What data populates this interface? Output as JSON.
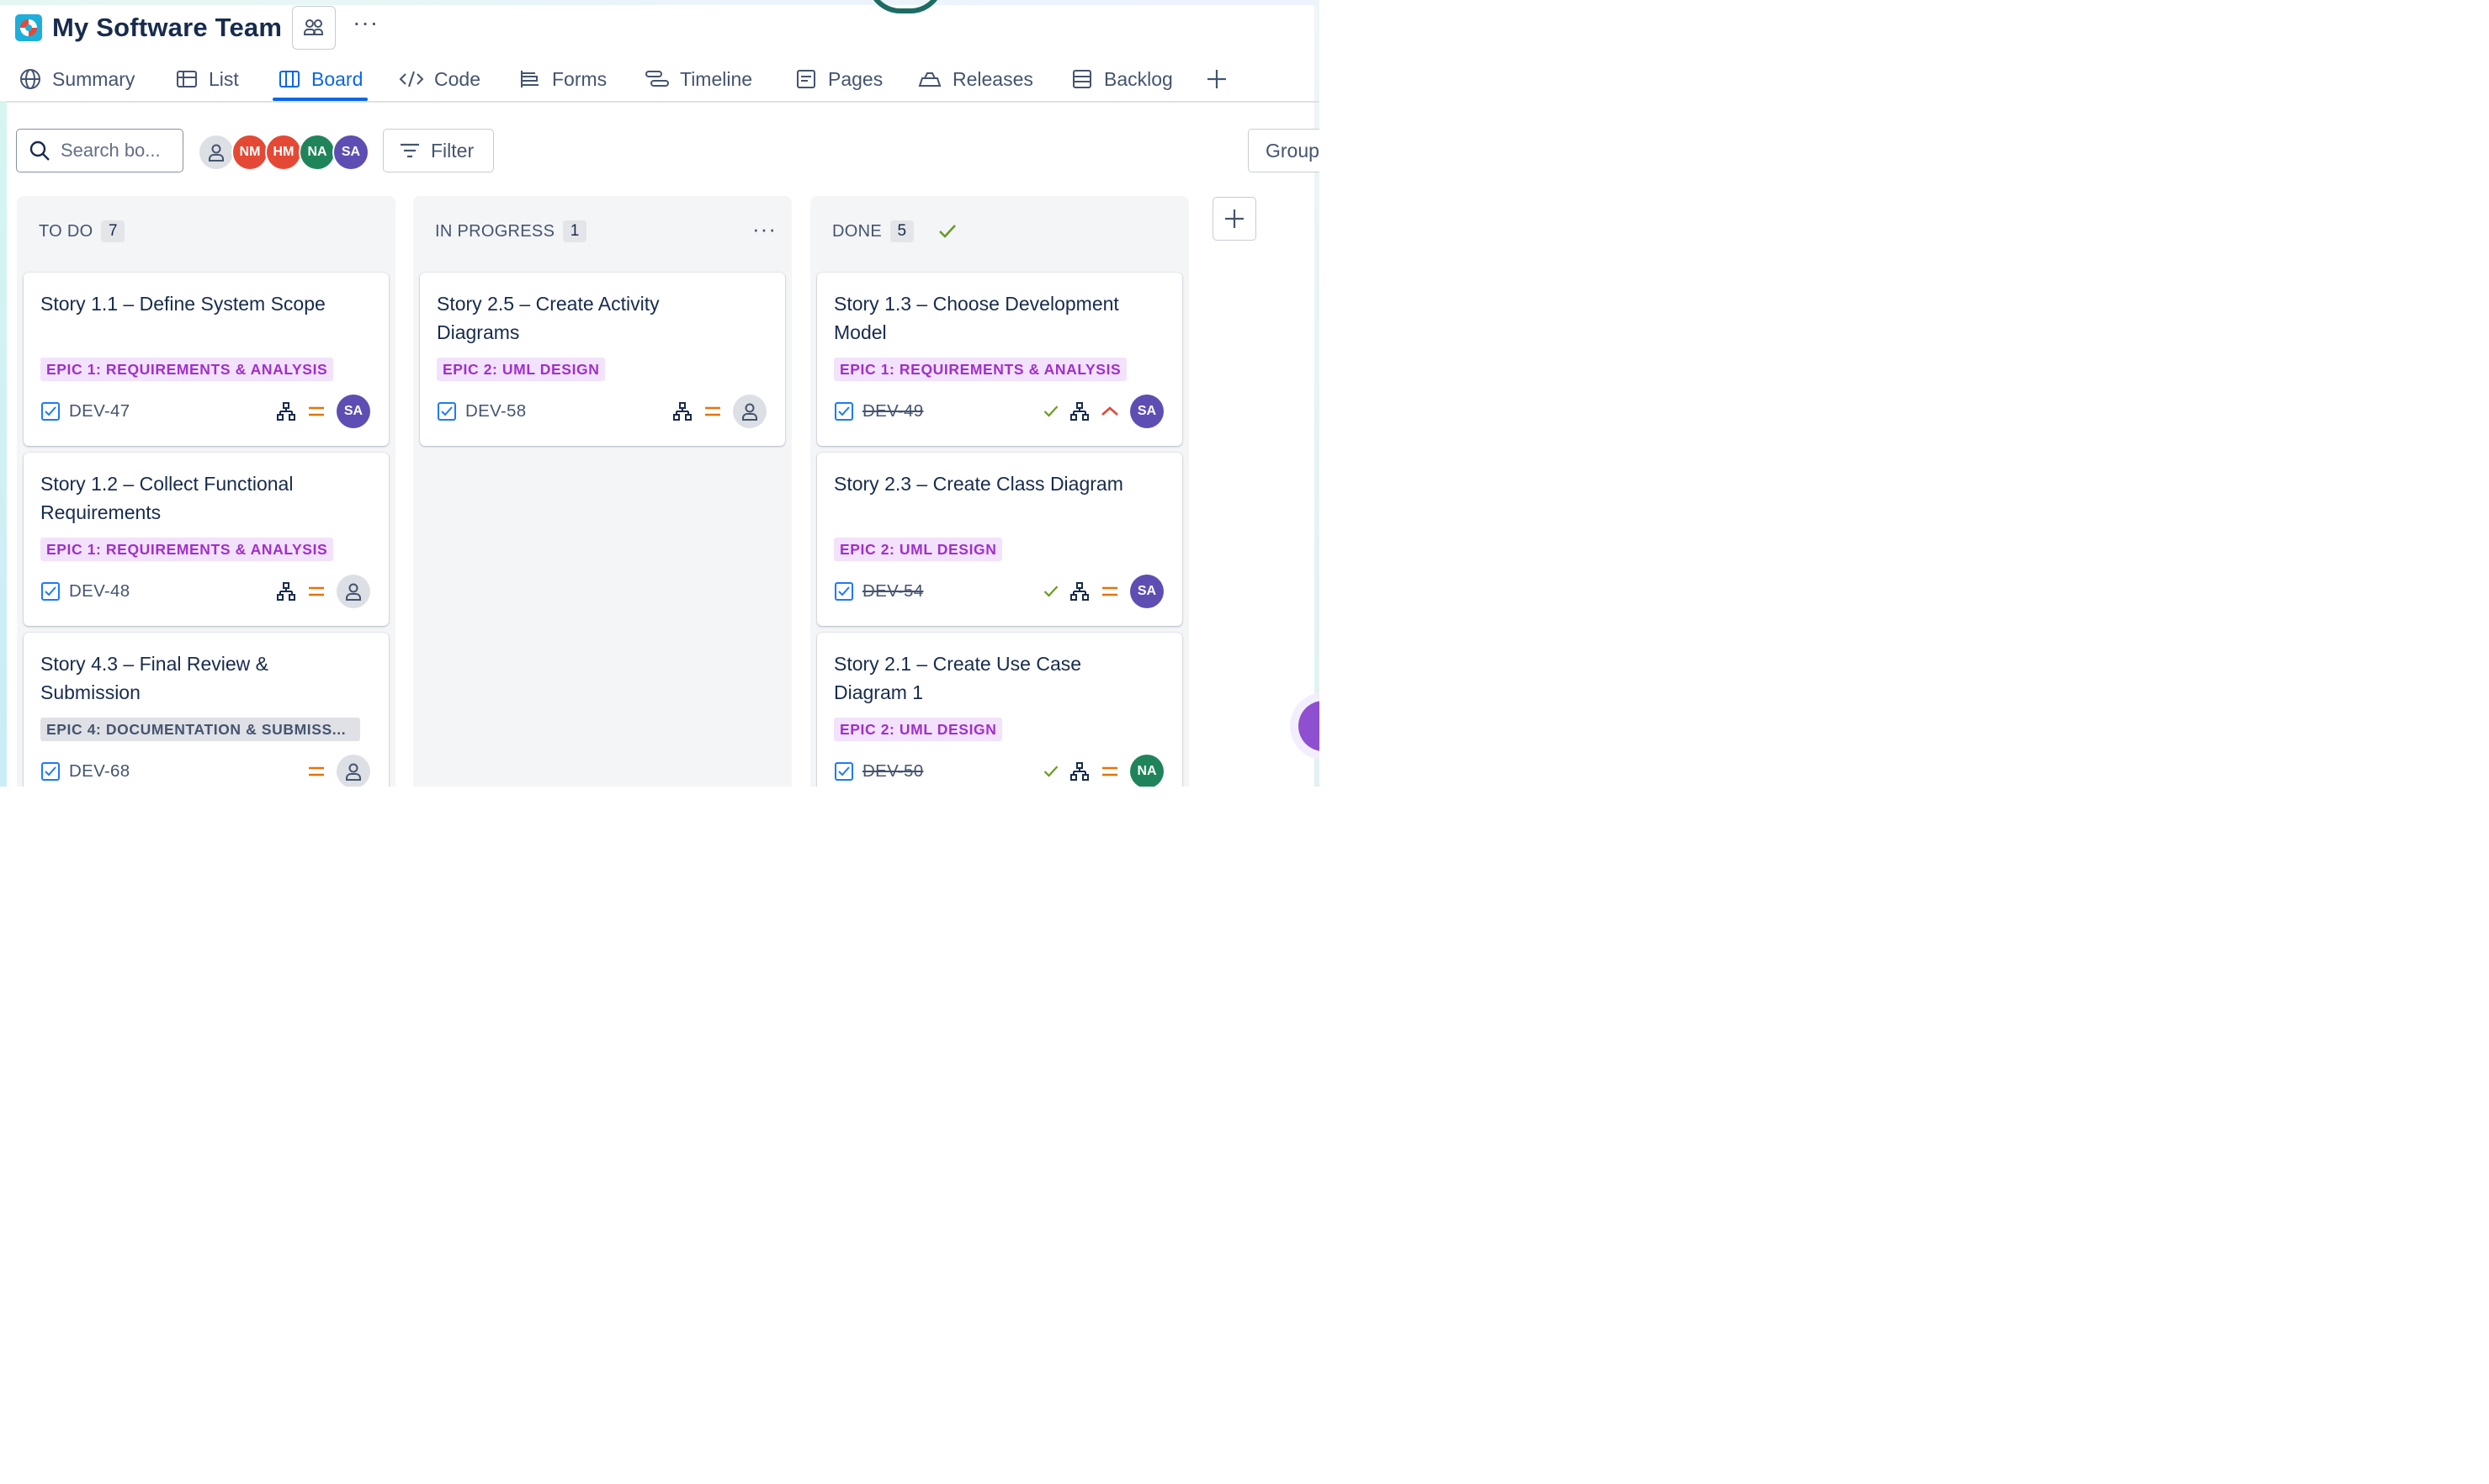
{
  "project": {
    "title": "My Software Team"
  },
  "tabs": [
    {
      "label": "Summary",
      "icon": "globe-icon"
    },
    {
      "label": "List",
      "icon": "list-icon"
    },
    {
      "label": "Board",
      "icon": "board-icon",
      "active": true
    },
    {
      "label": "Code",
      "icon": "code-icon"
    },
    {
      "label": "Forms",
      "icon": "forms-icon"
    },
    {
      "label": "Timeline",
      "icon": "timeline-icon"
    },
    {
      "label": "Pages",
      "icon": "pages-icon"
    },
    {
      "label": "Releases",
      "icon": "releases-icon"
    },
    {
      "label": "Backlog",
      "icon": "backlog-icon"
    }
  ],
  "toolbar": {
    "search_placeholder": "Search bo...",
    "avatars": [
      {
        "initials": "",
        "color": "#dcdfe4"
      },
      {
        "initials": "NM",
        "color": "#e34935"
      },
      {
        "initials": "HM",
        "color": "#e34935"
      },
      {
        "initials": "NA",
        "color": "#1f845a"
      },
      {
        "initials": "SA",
        "color": "#5e4db2"
      }
    ],
    "filter_label": "Filter",
    "group_label": "Group"
  },
  "columns": [
    {
      "name": "TO DO",
      "count": "7",
      "cards": [
        {
          "title": "Story 1.1 – Define System Scope",
          "epic": "EPIC 1: REQUIREMENTS & ANALYSIS",
          "key": "DEV-47",
          "assignee": "SA"
        },
        {
          "title": "Story 1.2 – Collect Functional Requirements",
          "epic": "EPIC 1: REQUIREMENTS & ANALYSIS",
          "key": "DEV-48",
          "assignee": ""
        },
        {
          "title": "Story 4.3 – Final Review & Submission",
          "epic": "EPIC 4: DOCUMENTATION & SUBMISS...",
          "key": "DEV-68",
          "assignee": ""
        }
      ]
    },
    {
      "name": "IN PROGRESS",
      "count": "1",
      "cards": [
        {
          "title": "Story 2.5 – Create Activity Diagrams",
          "epic": "EPIC 2: UML DESIGN",
          "key": "DEV-58",
          "assignee": ""
        }
      ]
    },
    {
      "name": "DONE",
      "count": "5",
      "cards": [
        {
          "title": "Story 1.3 – Choose Development Model",
          "epic": "EPIC 1: REQUIREMENTS & ANALYSIS",
          "key": "DEV-49",
          "assignee": "SA",
          "priority": "high"
        },
        {
          "title": "Story 2.3 – Create Class Diagram",
          "epic": "EPIC 2: UML DESIGN",
          "key": "DEV-54",
          "assignee": "SA",
          "priority": "medium"
        },
        {
          "title": "Story 2.1 – Create Use Case Diagram 1",
          "epic": "EPIC 2: UML DESIGN",
          "key": "DEV-50",
          "assignee": "NA",
          "priority": "medium"
        }
      ]
    }
  ],
  "colors": {
    "accent": "#0c66e4",
    "sa": "#5e4db2",
    "na": "#1f845a",
    "medium_priority": "#e2740b",
    "high_priority": "#e34935",
    "done_check": "#6a9a23"
  }
}
